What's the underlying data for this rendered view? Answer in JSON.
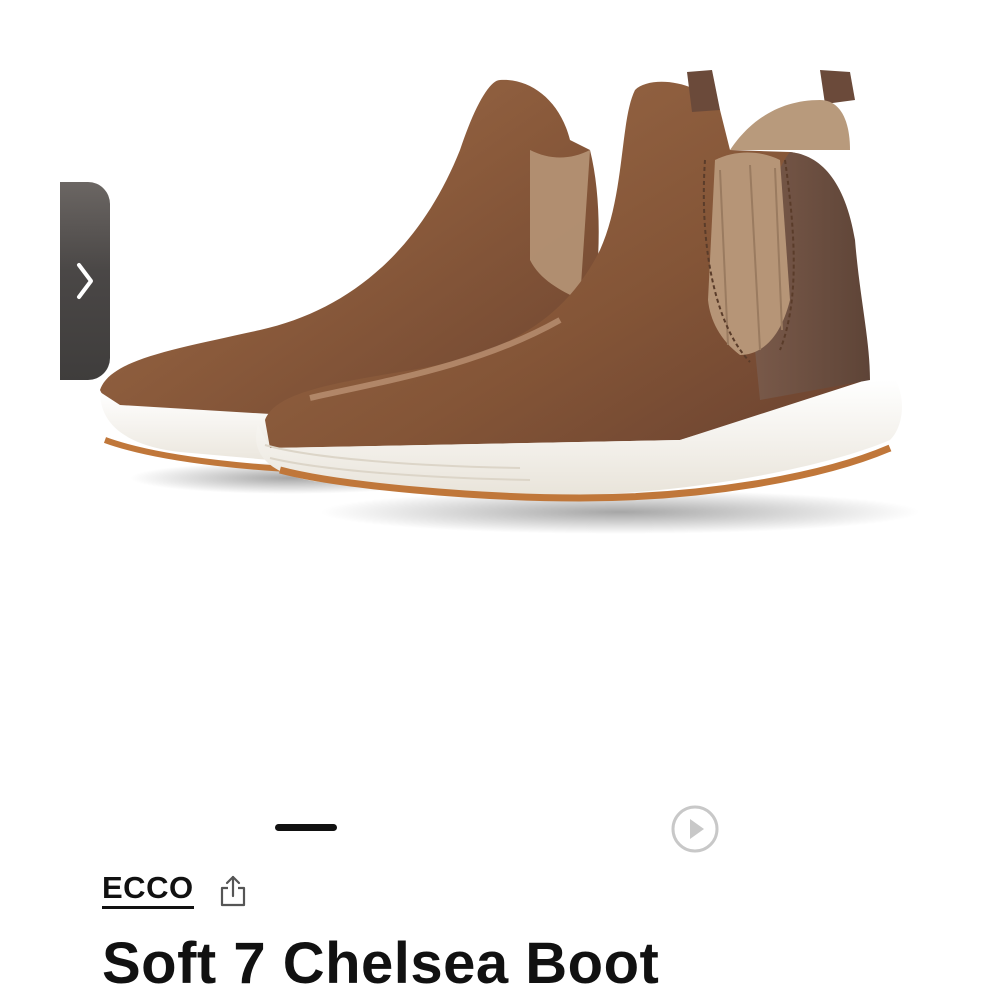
{
  "product": {
    "brand": "ECCO",
    "title": "Soft 7 Chelsea Boot",
    "image_description_icon": "chelsea-boot-image"
  },
  "carousel": {
    "arrow_icon": "chevron-right-icon",
    "indicator_icon": "active-slide-indicator",
    "play_icon": "play-icon"
  },
  "actions": {
    "share_icon": "share-icon"
  },
  "colors": {
    "leather": "#8a5a3b",
    "elastic": "#b69577",
    "sole": "#f3efe8",
    "text": "#111111"
  }
}
